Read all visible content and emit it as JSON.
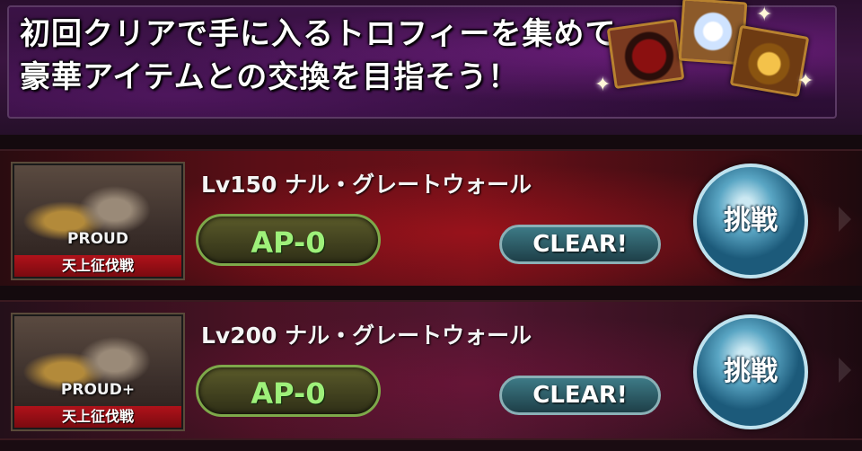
{
  "banner": {
    "lines": [
      "初回クリアで手に入るトロフィーを集めて",
      "豪華アイテムとの交換を目指そう！"
    ],
    "icons": [
      "ruby-gem-icon",
      "crystal-icon",
      "gold-ring-icon"
    ]
  },
  "quests": [
    {
      "rank": "PROUD",
      "type": "天上征伐戦",
      "title": "Lv150 ナル・グレートウォール",
      "ap": "AP-0",
      "status": "CLEAR!",
      "action": "挑戦"
    },
    {
      "rank": "PROUD+",
      "type": "天上征伐戦",
      "title": "Lv200 ナル・グレートウォール",
      "ap": "AP-0",
      "status": "CLEAR!",
      "action": "挑戦"
    }
  ],
  "colors": {
    "ap_text": "#9ef07a",
    "clear_badge": "#3d7a86",
    "challenge_button": "#5aa6c4",
    "type_label_bg": "#b0121a"
  }
}
